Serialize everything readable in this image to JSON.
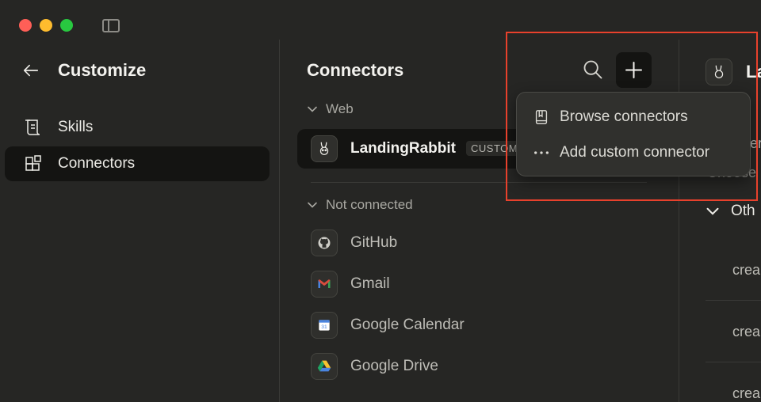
{
  "sidebar": {
    "title": "Customize",
    "items": [
      {
        "label": "Skills",
        "icon": "scroll-icon"
      },
      {
        "label": "Connectors",
        "icon": "connectors-icon",
        "selected": true
      }
    ]
  },
  "connectors": {
    "title": "Connectors",
    "web_section": "Web",
    "connected": {
      "name": "LandingRabbit",
      "badge": "CUSTOM"
    },
    "not_connected_section": "Not connected",
    "items": [
      {
        "label": "GitHub",
        "icon": "github-icon"
      },
      {
        "label": "Gmail",
        "icon": "gmail-icon"
      },
      {
        "label": "Google Calendar",
        "icon": "google-calendar-icon"
      },
      {
        "label": "Google Drive",
        "icon": "google-drive-icon"
      }
    ]
  },
  "dropdown": {
    "browse": "Browse connectors",
    "add_custom": "Add custom connector"
  },
  "detail": {
    "title_fragment": "La",
    "fragment1": "er",
    "fragment2": "Choose",
    "other_section": "Oth",
    "items": [
      "crea",
      "crea",
      "crea"
    ]
  },
  "colors": {
    "highlight": "#e8412c",
    "background": "#262624"
  }
}
